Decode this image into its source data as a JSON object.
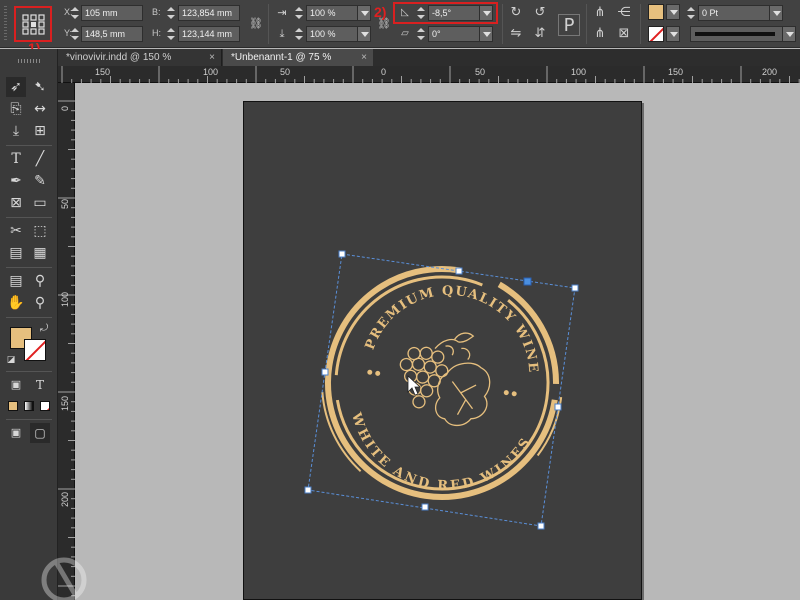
{
  "control_bar": {
    "x_label": "X:",
    "y_label": "Y:",
    "x_value": "105 mm",
    "y_value": "148,5 mm",
    "w_label": "B:",
    "h_label": "H:",
    "w_value": "123,854 mm",
    "h_value": "123,144 mm",
    "scale_x": "100 %",
    "scale_y": "100 %",
    "rotation": "-8,5°",
    "shear": "0°",
    "stroke_weight": "0 Pt",
    "fill_color": "#e6bf7e",
    "callout_1": "1)",
    "callout_2": "2)"
  },
  "tabs": [
    {
      "label": "*vinovivir.indd @ 150 %",
      "close": "×"
    },
    {
      "label": "*Unbenannt-1 @ 75 %",
      "close": "×"
    }
  ],
  "ruler_top": [
    "150",
    "100",
    "50",
    "0",
    "50",
    "100",
    "150",
    "200"
  ],
  "ruler_left": [
    "0",
    "50",
    "100",
    "150",
    "200"
  ],
  "logo": {
    "top_text": "PREMIUM QUALITY WINE",
    "bottom_text": "WHITE AND RED WINES",
    "color": "#e6bf7e"
  },
  "swatches": {
    "fill": "#e6bf7e",
    "stroke": "none"
  }
}
